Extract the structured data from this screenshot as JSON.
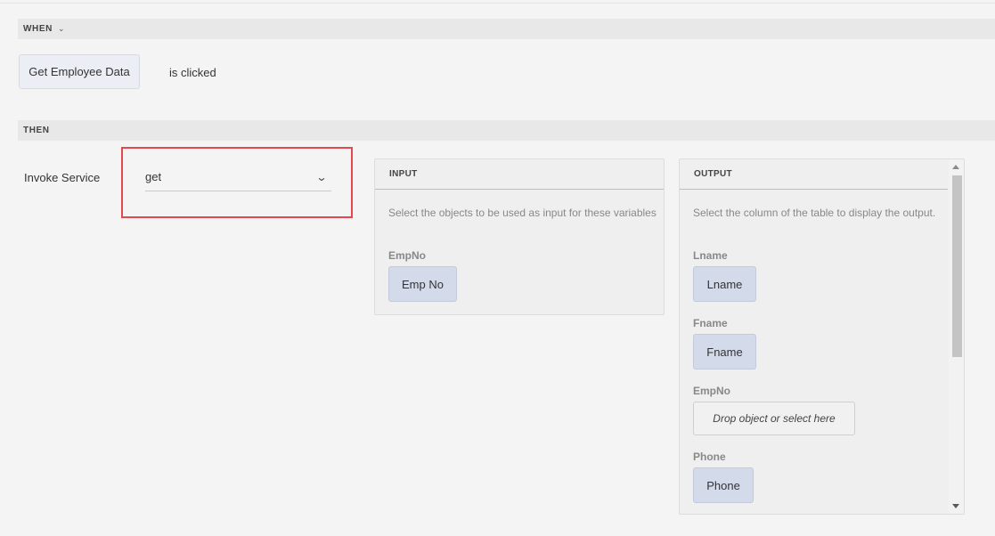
{
  "when": {
    "section_label": "WHEN",
    "component": "Get Employee Data",
    "event": "is clicked"
  },
  "then": {
    "section_label": "THEN",
    "action_label": "Invoke Service",
    "service_value": "get"
  },
  "input_panel": {
    "title": "INPUT",
    "description": "Select the objects to be used as input for these variables",
    "fields": [
      {
        "label": "EmpNo",
        "value": "Emp No"
      }
    ]
  },
  "output_panel": {
    "title": "OUTPUT",
    "description": "Select the column of the table to display the output.",
    "fields": [
      {
        "label": "Lname",
        "value": "Lname"
      },
      {
        "label": "Fname",
        "value": "Fname"
      },
      {
        "label": "EmpNo",
        "placeholder": "Drop object or select here"
      },
      {
        "label": "Phone",
        "value": "Phone"
      }
    ]
  },
  "colors": {
    "highlight": "#e34850",
    "chip_background": "#d3dbea",
    "section_bar": "#e8e8e8"
  }
}
